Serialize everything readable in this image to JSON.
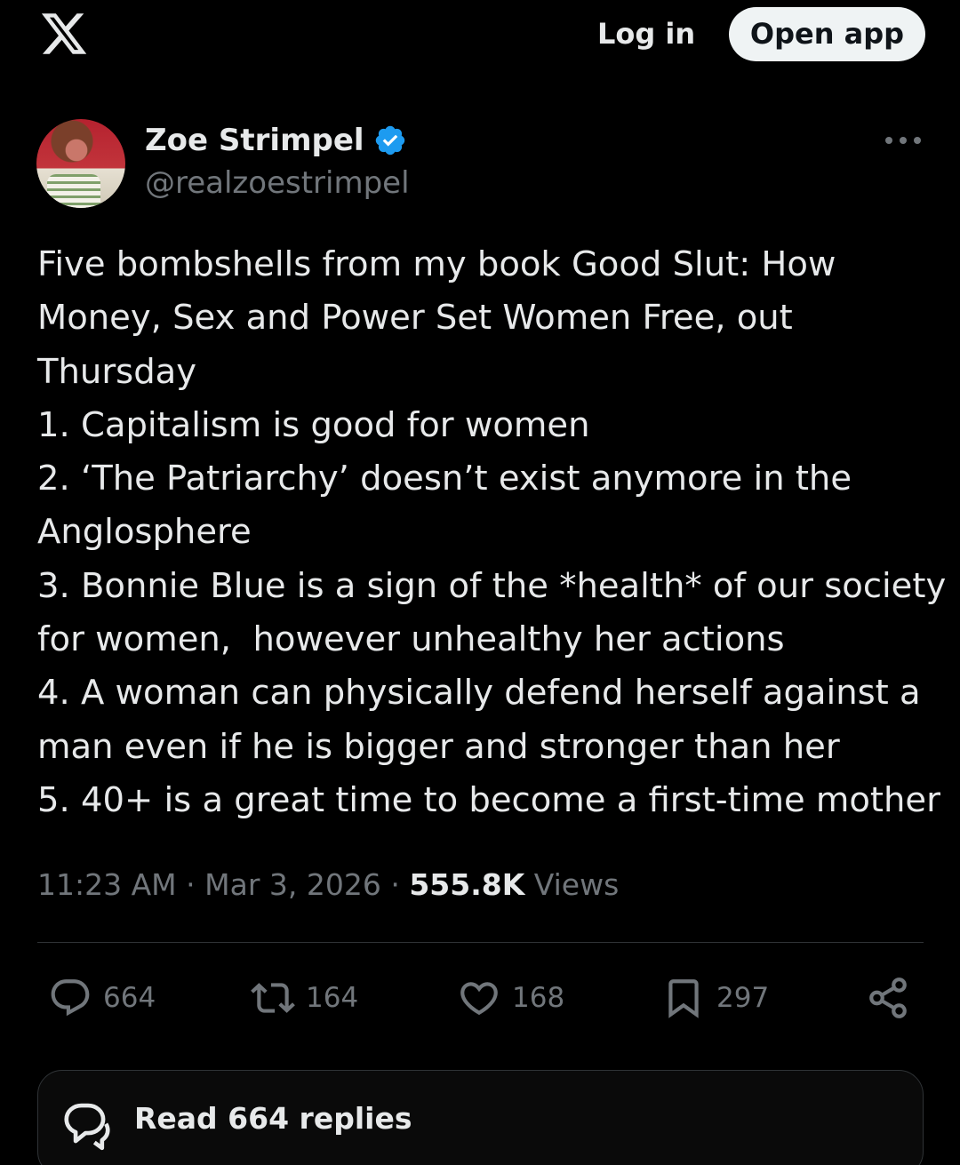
{
  "header": {
    "logo_icon": "x-logo-icon",
    "login_label": "Log in",
    "open_app_label": "Open app"
  },
  "author": {
    "name": "Zoe Strimpel",
    "handle": "@realzoestrimpel",
    "verified": true,
    "verified_color": "#1d9bf0"
  },
  "tweet": {
    "lines": [
      "Five bombshells from my book Good Slut: How",
      "Money, Sex and Power Set Women Free, out",
      "Thursday",
      "1. Capitalism is good for women",
      "2. ‘The Patriarchy’ doesn’t exist anymore in the",
      "Anglosphere",
      "3. Bonnie Blue is a sign of the *health* of our society",
      "for women,  however unhealthy her actions",
      "4. A woman can physically defend herself against a",
      "man even if he is bigger and stronger than her",
      "5. 40+ is a great time to become a first-time mother"
    ]
  },
  "meta": {
    "time": "11:23 AM",
    "separator": " · ",
    "date": "Mar 3, 2026",
    "views_count": "555.8K",
    "views_label": " Views"
  },
  "actions": {
    "replies": "664",
    "reposts": "164",
    "likes": "168",
    "bookmarks": "297"
  },
  "read_replies_label": "Read 664 replies"
}
